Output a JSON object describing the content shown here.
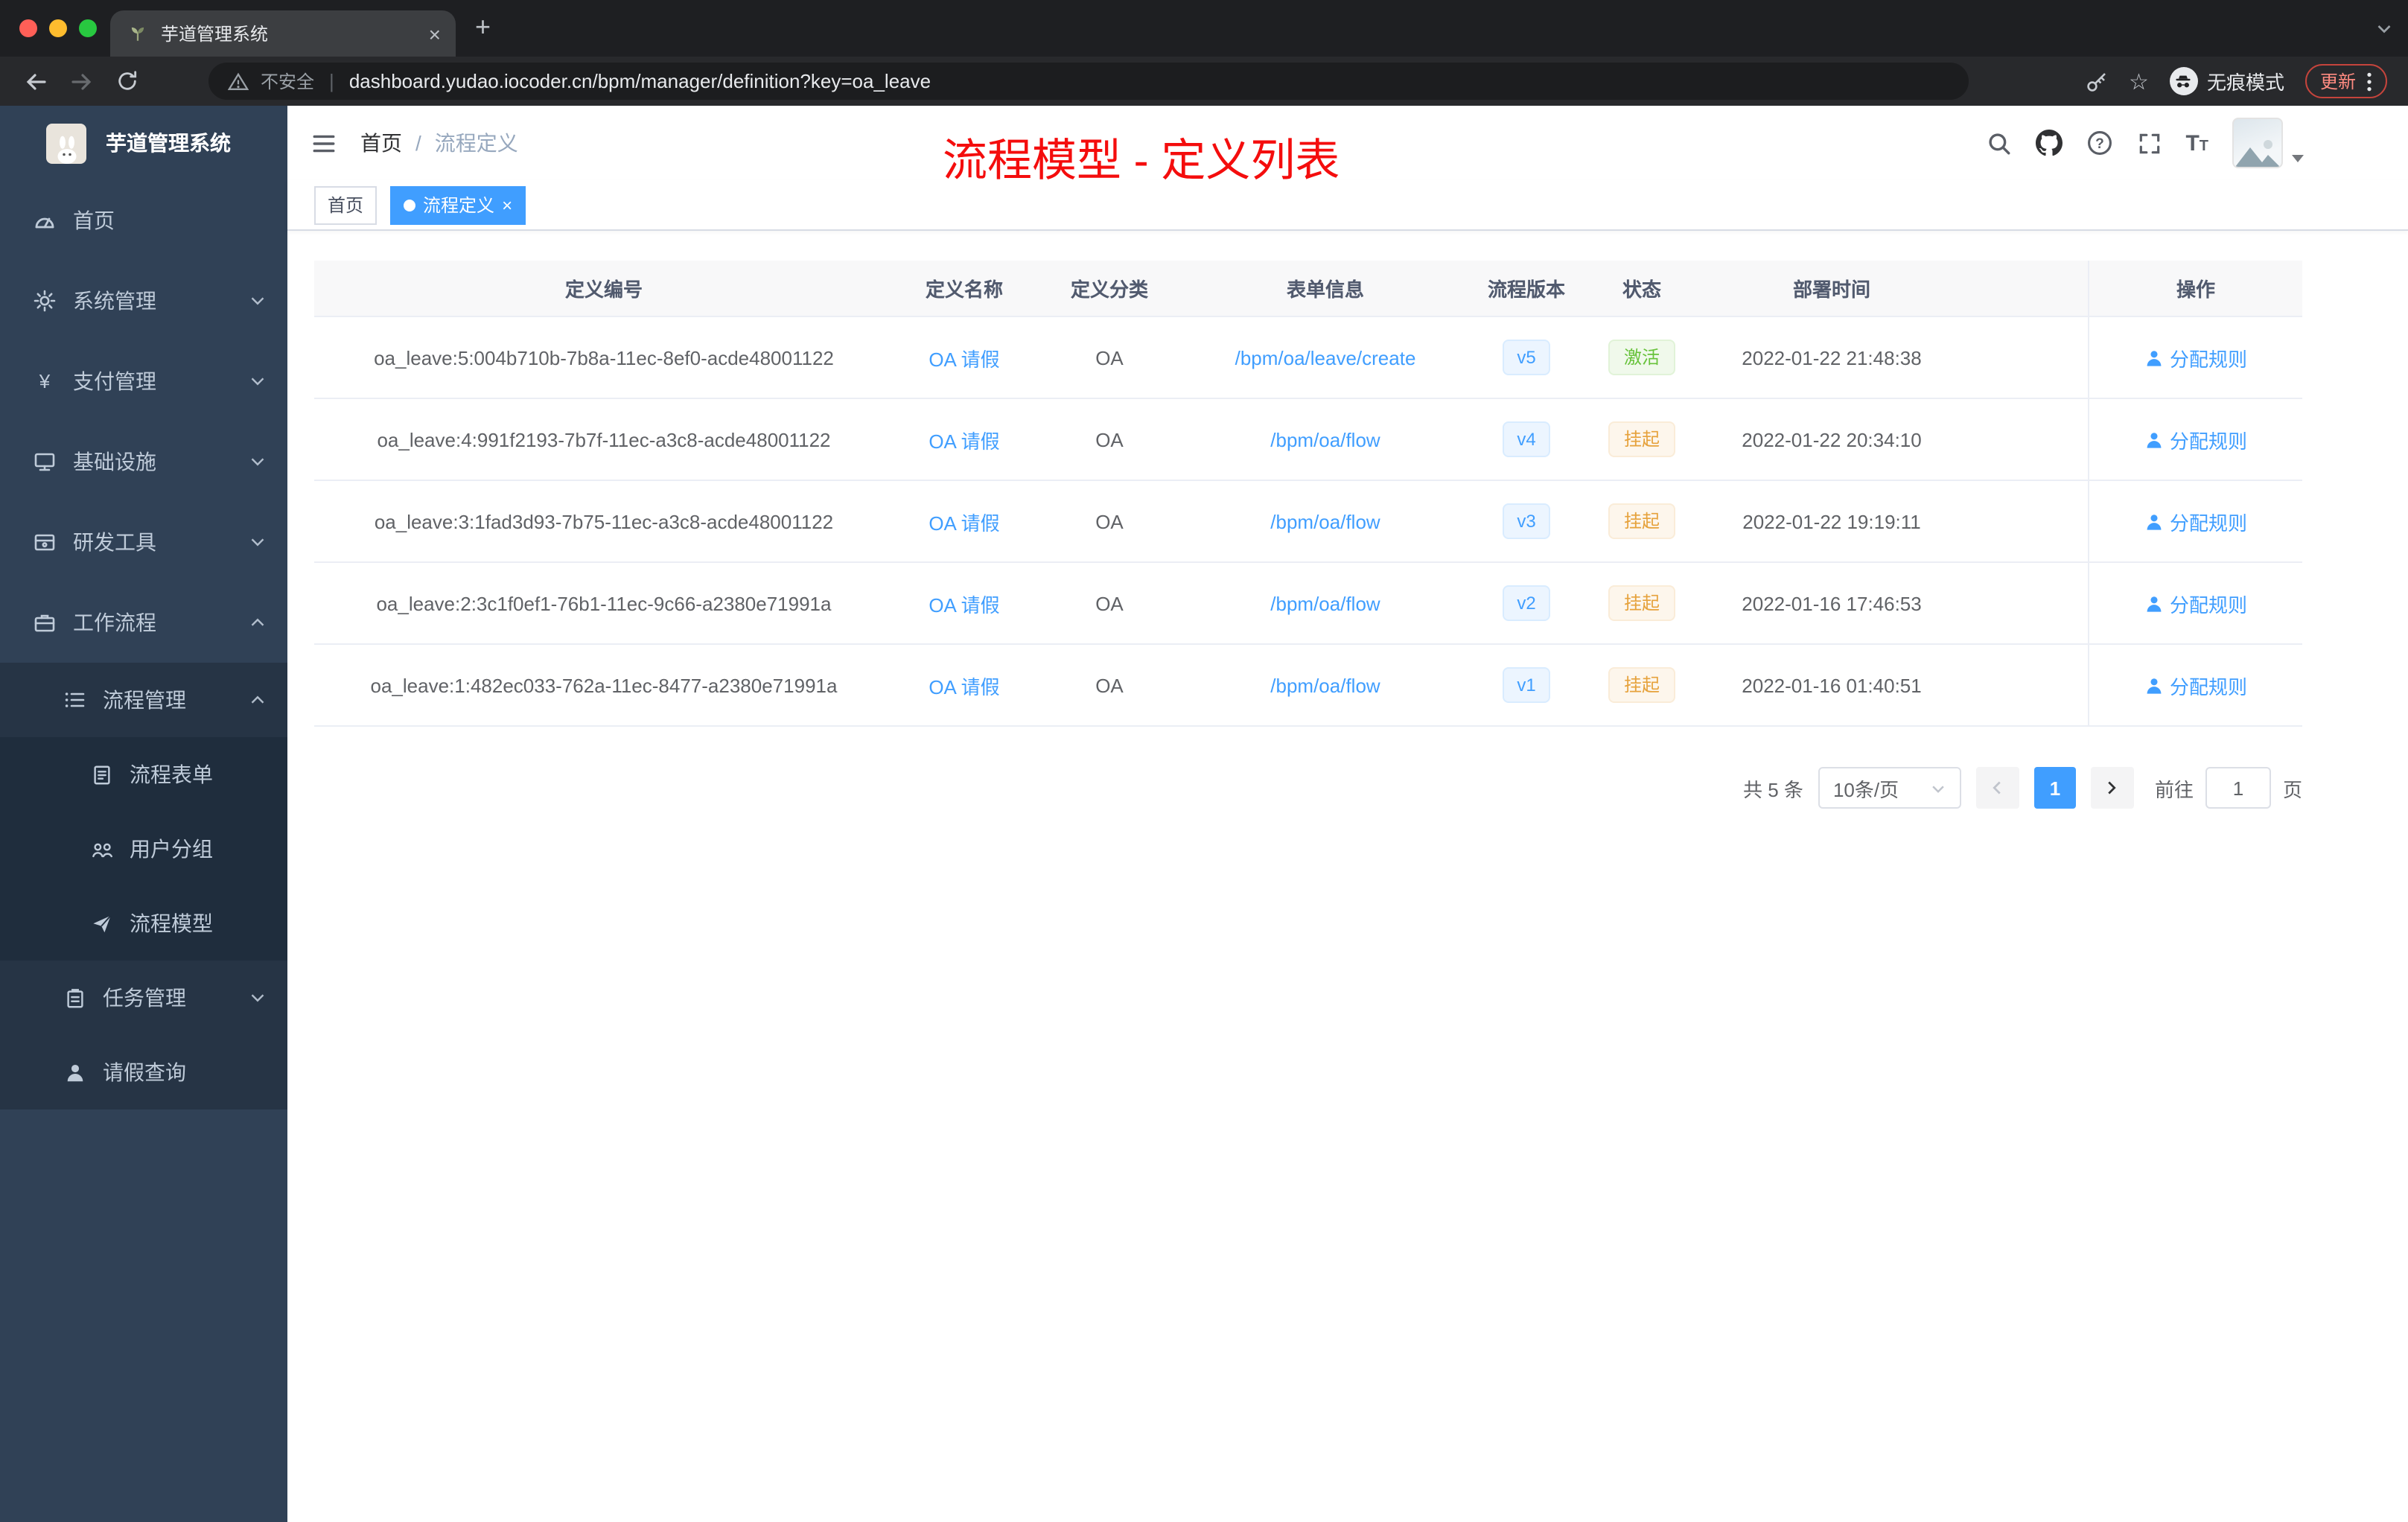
{
  "colors": {
    "accent": "#409eff",
    "success": "#67c23a",
    "warning": "#e6a23c",
    "annotation_red": "#f40d0d",
    "sidebar_bg": "#304156"
  },
  "browser": {
    "tab_title": "芋道管理系统",
    "security_label": "不安全",
    "url": "dashboard.yudao.iocoder.cn/bpm/manager/definition?key=oa_leave",
    "incognito_label": "无痕模式",
    "update_label": "更新"
  },
  "sidebar": {
    "brand": "芋道管理系统",
    "menu": [
      {
        "label": "首页"
      },
      {
        "label": "系统管理"
      },
      {
        "label": "支付管理"
      },
      {
        "label": "基础设施"
      },
      {
        "label": "研发工具"
      },
      {
        "label": "工作流程"
      },
      {
        "label": "流程管理"
      },
      {
        "label": "流程表单"
      },
      {
        "label": "用户分组"
      },
      {
        "label": "流程模型"
      },
      {
        "label": "任务管理"
      },
      {
        "label": "请假查询"
      }
    ]
  },
  "navbar": {
    "breadcrumb_home": "首页",
    "breadcrumb_current": "流程定义",
    "annotation": "流程模型 - 定义列表"
  },
  "tags": {
    "home": "首页",
    "active": "流程定义"
  },
  "table": {
    "headers": [
      "定义编号",
      "定义名称",
      "定义分类",
      "表单信息",
      "流程版本",
      "状态",
      "部署时间",
      "操作"
    ],
    "rows": [
      {
        "id": "oa_leave:5:004b710b-7b8a-11ec-8ef0-acde48001122",
        "name": "OA 请假",
        "category": "OA",
        "form": "/bpm/oa/leave/create",
        "version": "v5",
        "status": "激活",
        "status_type": "success",
        "time": "2022-01-22 21:48:38",
        "action": "分配规则"
      },
      {
        "id": "oa_leave:4:991f2193-7b7f-11ec-a3c8-acde48001122",
        "name": "OA 请假",
        "category": "OA",
        "form": "/bpm/oa/flow",
        "version": "v4",
        "status": "挂起",
        "status_type": "warning",
        "time": "2022-01-22 20:34:10",
        "action": "分配规则"
      },
      {
        "id": "oa_leave:3:1fad3d93-7b75-11ec-a3c8-acde48001122",
        "name": "OA 请假",
        "category": "OA",
        "form": "/bpm/oa/flow",
        "version": "v3",
        "status": "挂起",
        "status_type": "warning",
        "time": "2022-01-22 19:19:11",
        "action": "分配规则"
      },
      {
        "id": "oa_leave:2:3c1f0ef1-76b1-11ec-9c66-a2380e71991a",
        "name": "OA 请假",
        "category": "OA",
        "form": "/bpm/oa/flow",
        "version": "v2",
        "status": "挂起",
        "status_type": "warning",
        "time": "2022-01-16 17:46:53",
        "action": "分配规则"
      },
      {
        "id": "oa_leave:1:482ec033-762a-11ec-8477-a2380e71991a",
        "name": "OA 请假",
        "category": "OA",
        "form": "/bpm/oa/flow",
        "version": "v1",
        "status": "挂起",
        "status_type": "warning",
        "time": "2022-01-16 01:40:51",
        "action": "分配规则"
      }
    ]
  },
  "pagination": {
    "total": "共 5 条",
    "page_size": "10条/页",
    "current_page": "1",
    "goto_prefix": "前往",
    "goto_value": "1",
    "goto_suffix": "页"
  }
}
